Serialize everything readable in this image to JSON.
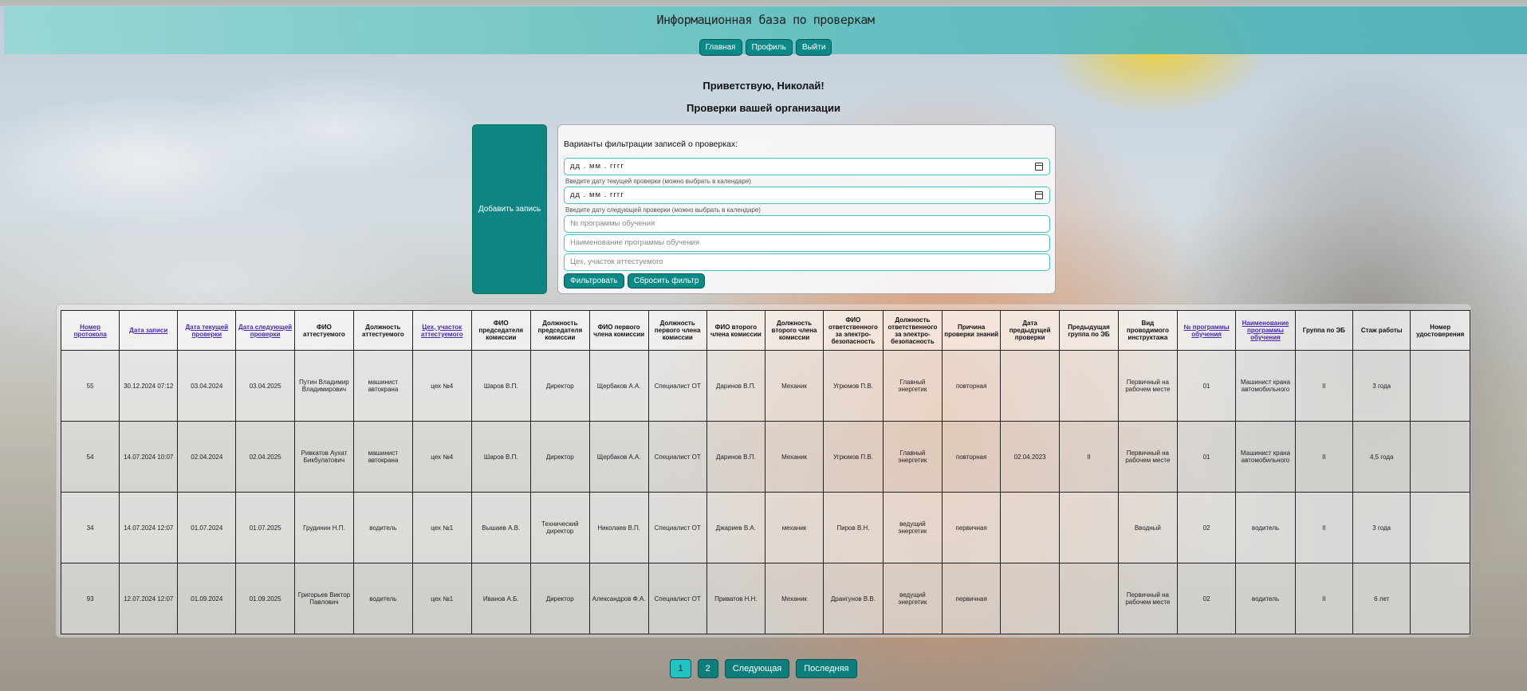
{
  "header": {
    "title": "Информационная база по проверкам",
    "nav": [
      "Главная",
      "Профиль",
      "Выйти"
    ]
  },
  "greeting": "Приветствую, Николай!",
  "section_title": "Проверки вашей организации",
  "add_button": "Добавить запись",
  "filter": {
    "heading": "Варианты фильтрации записей о проверках:",
    "date_current_value": "дд . мм . гггг",
    "date_current_hint": "Введите дату текущей проверки (можно выбрать в календаре)",
    "date_next_value": "дд . мм . гггг",
    "date_next_hint": "Введите дату следующей проверки (можно выбрать в календаре)",
    "program_no_placeholder": "№ программы обучения",
    "program_name_placeholder": "Наименование программы обучения",
    "workshop_placeholder": "Цех, участок аттестуемого",
    "apply": "Фильтровать",
    "reset": "Сбросить фильтр"
  },
  "table": {
    "columns": [
      {
        "label": "Номер протокола",
        "sortable": true
      },
      {
        "label": "Дата записи",
        "sortable": true
      },
      {
        "label": "Дата текущей проверки",
        "sortable": true
      },
      {
        "label": "Дата следующей проверки",
        "sortable": true
      },
      {
        "label": "ФИО аттестуемого",
        "sortable": false
      },
      {
        "label": "Должность аттестуемого",
        "sortable": false
      },
      {
        "label": "Цех, участок аттестуемого",
        "sortable": true
      },
      {
        "label": "ФИО председателя комиссии",
        "sortable": false
      },
      {
        "label": "Должность председателя комиссии",
        "sortable": false
      },
      {
        "label": "ФИО первого члена комиссии",
        "sortable": false
      },
      {
        "label": "Должность первого члена комиссии",
        "sortable": false
      },
      {
        "label": "ФИО второго члена комиссии",
        "sortable": false
      },
      {
        "label": "Должность второго члена комиссии",
        "sortable": false
      },
      {
        "label": "ФИО ответственного за электро-безопасность",
        "sortable": false
      },
      {
        "label": "Должность ответственного за электро-безопасность",
        "sortable": false
      },
      {
        "label": "Причина проверки знаний",
        "sortable": false
      },
      {
        "label": "Дата предыдущей проверки",
        "sortable": false
      },
      {
        "label": "Предыдущая группа по ЭБ",
        "sortable": false
      },
      {
        "label": "Вид проводимого инструктажа",
        "sortable": false
      },
      {
        "label": "№ программы обучения",
        "sortable": true
      },
      {
        "label": "Наименование программы обучения",
        "sortable": true
      },
      {
        "label": "Группа по ЭБ",
        "sortable": false
      },
      {
        "label": "Стаж работы",
        "sortable": false
      },
      {
        "label": "Номер удостоверения",
        "sortable": false
      }
    ],
    "rows": [
      [
        "55",
        "30.12.2024 07:12",
        "03.04.2024",
        "03.04.2025",
        "Путин Владимир Владимирович",
        "машинист автокрана",
        "цех №4",
        "Шаров В.П.",
        "Директор",
        "Щербаков А.А.",
        "Специалист ОТ",
        "Даринов В.П.",
        "Механик",
        "Угрюмов П.В.",
        "Главный энергетик",
        "повторная",
        "",
        "",
        "Первичный на рабочем месте",
        "01",
        "Машинист крана автомобильного",
        "II",
        "3 года",
        ""
      ],
      [
        "54",
        "14.07.2024 10:07",
        "02.04.2024",
        "02.04.2025",
        "Ривкатов Аухат Бикбулатович",
        "машинист автокрана",
        "цех №4",
        "Шаров В.П.",
        "Директор",
        "Щербаков А.А.",
        "Специалист ОТ",
        "Даринов В.П.",
        "Механик",
        "Угрюмов П.В.",
        "Главный энергетик",
        "повторная",
        "02.04.2023",
        "II",
        "Первичный на рабочем месте",
        "01",
        "Машинист крана автомобильного",
        "II",
        "4,5 года",
        ""
      ],
      [
        "34",
        "14.07.2024 12:07",
        "01.07.2024",
        "01.07.2025",
        "Грудинин Н.П.",
        "водитель",
        "цех №1",
        "Вышаев А.В.",
        "Технический директор",
        "Николаев В.П.",
        "Специалист ОТ",
        "Джариев В.А.",
        "механик",
        "Пиров В.Н.",
        "ведущий энергетик",
        "первичная",
        "",
        "",
        "Вводный",
        "02",
        "водитель",
        "II",
        "3 года",
        ""
      ],
      [
        "93",
        "12.07.2024 12:07",
        "01.09.2024",
        "01.09.2025",
        "Григорьев Виктор Павлович",
        "водитель",
        "цех №1",
        "Иванов А.Б.",
        "Директор",
        "Александров Ф.А.",
        "Специалист ОТ",
        "Приватов Н.Н.",
        "Механик",
        "Дрангунов В.В.",
        "ведущий энергетик",
        "первичная",
        "",
        "",
        "Первичный на рабочем месте",
        "02",
        "водитель",
        "II",
        "6 лет",
        ""
      ]
    ]
  },
  "pagination": {
    "pages": [
      "1",
      "2"
    ],
    "current": "1",
    "next": "Следующая",
    "last": "Последняя"
  },
  "colors": {
    "accent": "#0c8a88",
    "accent_active": "#21c4c2",
    "header_bg": "#5fbebe",
    "input_border": "#45c4c0"
  }
}
